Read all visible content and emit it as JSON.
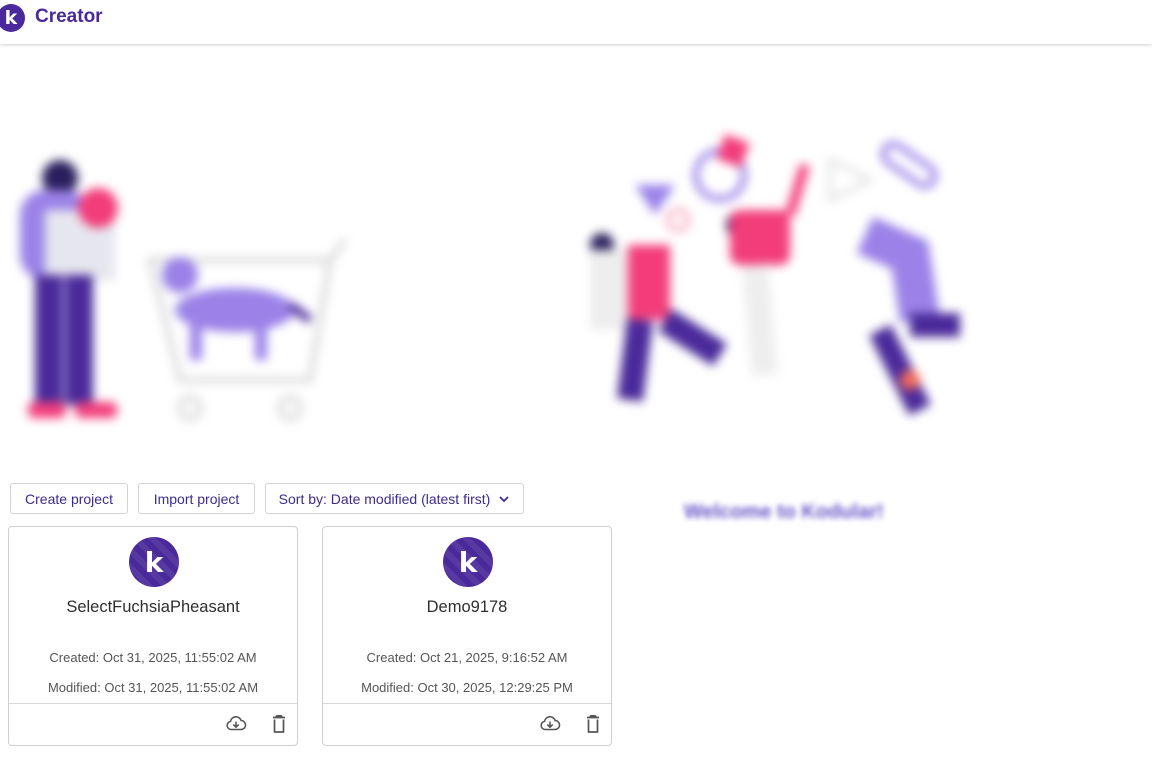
{
  "header": {
    "logo_letter": "k",
    "title": "Creator"
  },
  "toolbar": {
    "create_label": "Create project",
    "import_label": "Import project",
    "sort_label": "Sort by: Date modified (latest first)"
  },
  "welcome_text": "Welcome to Kodular!",
  "projects": [
    {
      "name": "SelectFuchsiaPheasant",
      "created": "Created: Oct 31, 2025, 11:55:02 AM",
      "modified": "Modified: Oct 31, 2025, 11:55:02 AM"
    },
    {
      "name": "Demo9178",
      "created": "Created: Oct 21, 2025, 9:16:52 AM",
      "modified": "Modified: Oct 30, 2025, 12:29:25 PM"
    }
  ],
  "icons": {
    "download": "cloud-download-icon",
    "delete": "trash-icon",
    "sort": "chevron-down-icon"
  },
  "colors": {
    "brand": "#4a2a9a",
    "button_text": "#3d2c8d",
    "accent_pink": "#f23d7a",
    "accent_lilac": "#9a82e8"
  }
}
